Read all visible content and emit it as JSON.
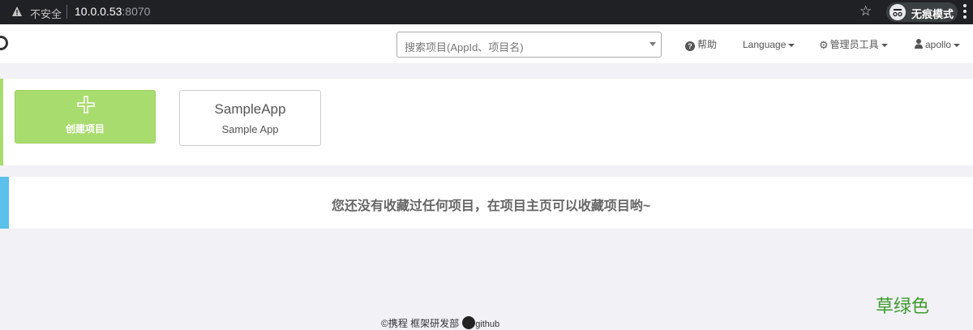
{
  "browser": {
    "insecure_label": "不安全",
    "url_host": "10.0.0.53",
    "url_port": ":8070",
    "incognito_label": "无痕模式"
  },
  "navbar": {
    "search_placeholder": "搜索项目(AppId、项目名)",
    "help_label": "帮助",
    "language_label": "Language",
    "admin_tools_label": "管理员工具",
    "user_label": "apollo"
  },
  "apps": {
    "create_label": "创建项目",
    "items": [
      {
        "app_id": "SampleApp",
        "name": "Sample App"
      }
    ],
    "accent_color": "#a9dc6e"
  },
  "favorites": {
    "empty_message": "您还没有收藏过任何项目，在项目主页可以收藏项目哟~",
    "accent_color": "#5bc0eb"
  },
  "footer": {
    "copyright_text": "携程 框架研发部",
    "github_label": "github"
  },
  "annotation": {
    "text": "草绿色"
  }
}
